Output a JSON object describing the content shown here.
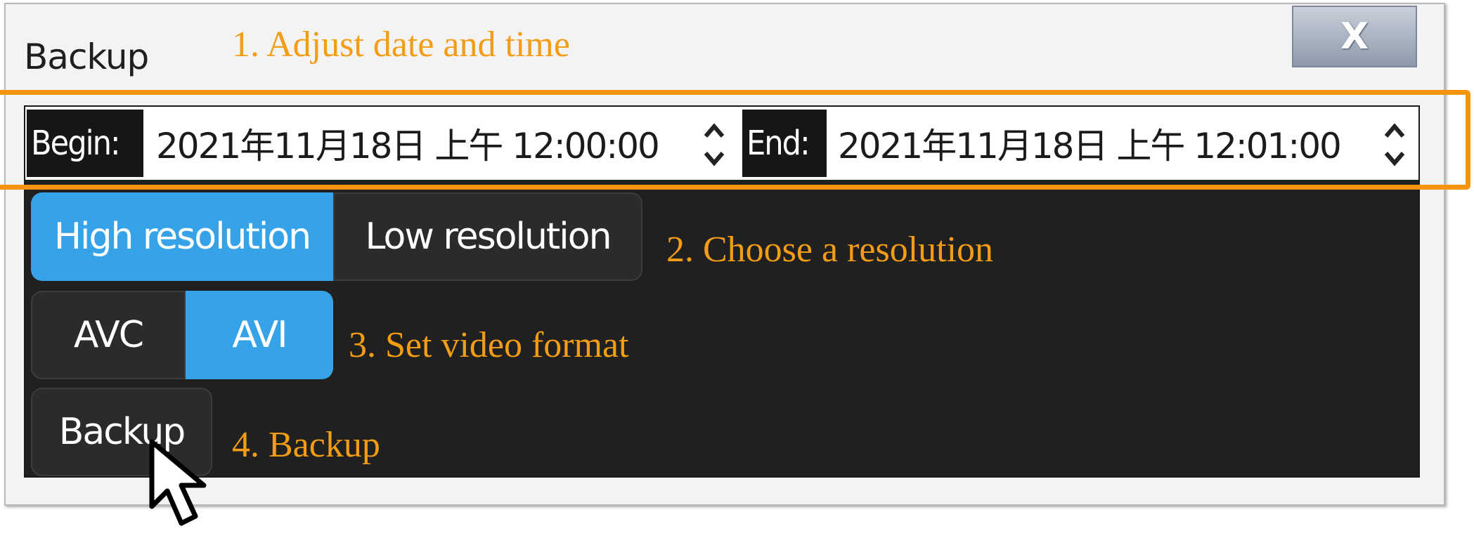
{
  "window": {
    "title": "Backup",
    "close_label": "X"
  },
  "date_range": {
    "begin_label": "Begin:",
    "begin_value": "2021年11月18日 上午 12:00:00",
    "end_label": "End:",
    "end_value": "2021年11月18日 上午 12:01:00"
  },
  "resolution": {
    "options": [
      "High resolution",
      "Low resolution"
    ],
    "selected": "High resolution"
  },
  "format": {
    "options": [
      "AVC",
      "AVI"
    ],
    "selected": "AVI"
  },
  "backup_button_label": "Backup",
  "annotations": {
    "step1": "1. Adjust date and time",
    "step2": "2.  Choose a resolution",
    "step3": "3. Set video format",
    "step4": "4. Backup"
  },
  "colors": {
    "annotation": "#f39c16",
    "selected": "#36a3e8",
    "panel": "#202020"
  },
  "icons": {
    "spinner": "up-down-spinner-icon",
    "cursor": "mouse-pointer-icon"
  }
}
